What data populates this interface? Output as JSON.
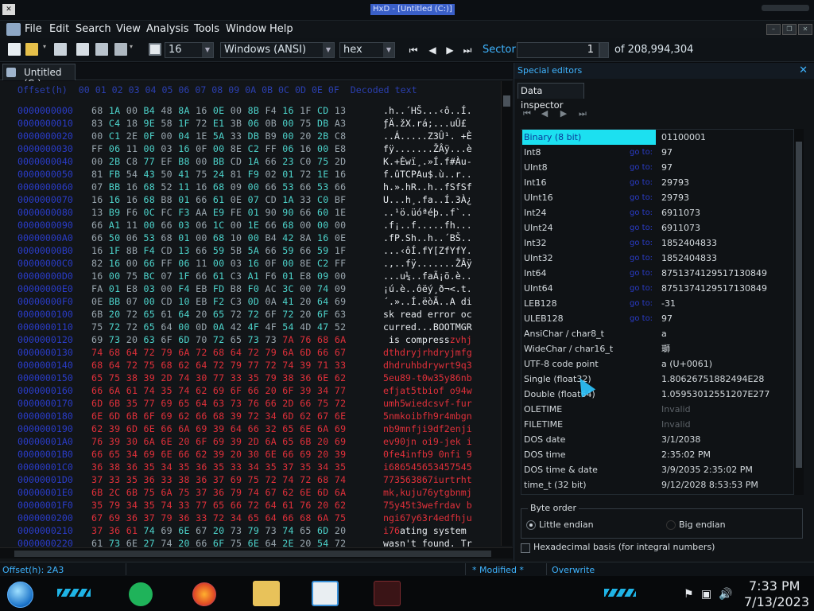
{
  "window": {
    "title": "HxD - [Untitled (C:)]",
    "logo_text": "✕"
  },
  "menu": [
    "File",
    "Edit",
    "Search",
    "View",
    "Analysis",
    "Tools",
    "Window",
    "Help"
  ],
  "toolbar": {
    "bytes_per_row": "16",
    "charset": "Windows (ANSI)",
    "display": "hex",
    "sector_label": "Sector",
    "sector_value": "1",
    "sector_total": "of 208,994,304"
  },
  "editor": {
    "tab_label": "Untitled (C:)",
    "header": "Offset(h)  00 01 02 03 04 05 06 07 08 09 0A 0B 0C 0D 0E 0F  Decoded text",
    "rows": [
      {
        "off": "0000000000",
        "hex": "68 1A 00 B4 48 8A 16 0E 00 8B F4 16 1F CD 13",
        "asc": ".h..´HŠ...‹ô..Í.",
        "style": "normal"
      },
      {
        "off": "0000000010",
        "hex": "83 C4 18 9E 58 1F 72 E1 3B 06 0B 00 75 DB A3",
        "asc": "ƒÄ.žX.rá;...uÛ£",
        "style": "normal"
      },
      {
        "off": "0000000020",
        "hex": "00 C1 2E 0F 00 04 1E 5A 33 DB B9 00 20 2B C8",
        "asc": "..Á.....Z3Û¹. +È",
        "style": "normal"
      },
      {
        "off": "0000000030",
        "hex": "FF 06 11 00 03 16 0F 00 8E C2 FF 06 16 00 E8",
        "asc": "fÿ.......ŽÂÿ...è",
        "style": "normal"
      },
      {
        "off": "0000000040",
        "hex": "00 2B C8 77 EF B8 00 BB CD 1A 66 23 C0 75 2D",
        "asc": "K.+Èwï¸.»Í.f#Àu-",
        "style": "normal"
      },
      {
        "off": "0000000050",
        "hex": "81 FB 54 43 50 41 75 24 81 F9 02 01 72 1E 16",
        "asc": "f.ûTCPAu$.ù..r..",
        "style": "normal"
      },
      {
        "off": "0000000060",
        "hex": "07 BB 16 68 52 11 16 68 09 00 66 53 66 53 66",
        "asc": "h.».hR..h..fSfSf",
        "style": "normal"
      },
      {
        "off": "0000000070",
        "hex": "16 16 16 68 B8 01 66 61 0E 07 CD 1A 33 C0 BF",
        "asc": "U...h¸.fa..Í.3À¿",
        "style": "normal"
      },
      {
        "off": "0000000080",
        "hex": "13 B9 F6 0C FC F3 AA E9 FE 01 90 90 66 60 1E",
        "asc": "..¹ö.üóªéþ..f`..",
        "style": "normal"
      },
      {
        "off": "0000000090",
        "hex": "66 A1 11 00 66 03 06 1C 00 1E 66 68 00 00 00",
        "asc": ".f¡..f.....fh...",
        "style": "normal"
      },
      {
        "off": "00000000A0",
        "hex": "66 50 06 53 68 01 00 68 10 00 B4 42 8A 16 0E",
        "asc": ".fP.Sh..h..´BŠ..",
        "style": "normal"
      },
      {
        "off": "00000000B0",
        "hex": "16 1F 8B F4 CD 13 66 59 5B 5A 66 59 66 59 1F",
        "asc": "...‹ôÍ.fY[ZfYfY.",
        "style": "normal"
      },
      {
        "off": "00000000C0",
        "hex": "82 16 00 66 FF 06 11 00 03 16 0F 00 8E C2 FF",
        "asc": ".,..fÿ.......ŽÂÿ",
        "style": "normal"
      },
      {
        "off": "00000000D0",
        "hex": "16 00 75 BC 07 1F 66 61 C3 A1 F6 01 E8 09 00",
        "asc": "...u¼..faÃ¡ö.è..",
        "style": "normal"
      },
      {
        "off": "00000000E0",
        "hex": "FA 01 E8 03 00 F4 EB FD B8 F0 AC 3C 00 74 09",
        "asc": "¡ú.è..ôëý¸ð¬<.t.",
        "style": "normal"
      },
      {
        "off": "00000000F0",
        "hex": "0E BB 07 00 CD 10 EB F2 C3 0D 0A 41 20 64 69",
        "asc": "´.»..Í.ëòÃ..A di",
        "style": "normal"
      },
      {
        "off": "0000000100",
        "hex": "6B 20 72 65 61 64 20 65 72 72 6F 72 20 6F 63",
        "asc": "sk read error oc",
        "style": "normal"
      },
      {
        "off": "0000000110",
        "hex": "75 72 72 65 64 00 0D 0A 42 4F 4F 54 4D 47 52",
        "asc": "curred...BOOTMGR",
        "style": "normal"
      },
      {
        "off": "0000000120",
        "hex": "69 73 20 63 6F 6D 70 72 65 73 73 7A 76 68 6A",
        "asc": " is compresszvhj",
        "style": "mixed",
        "split": 16
      },
      {
        "off": "0000000130",
        "hex": "74 68 64 72 79 6A 72 68 64 72 79 6A 6D 66 67",
        "asc": "dthdryjrhdryjmfg",
        "style": "red"
      },
      {
        "off": "0000000140",
        "hex": "68 64 72 75 68 62 64 72 79 77 72 74 39 71 33",
        "asc": "dhdruhbdrywrt9q3",
        "style": "red"
      },
      {
        "off": "0000000150",
        "hex": "65 75 38 39 2D 74 30 77 33 35 79 38 36 6E 62",
        "asc": "5eu89-t0w35y86nb",
        "style": "red"
      },
      {
        "off": "0000000160",
        "hex": "66 6A 61 74 35 74 62 69 6F 66 20 6F 39 34 77",
        "asc": "efjat5tbiof o94w",
        "style": "red"
      },
      {
        "off": "0000000170",
        "hex": "6D 6B 35 77 69 65 64 63 73 76 66 2D 66 75 72",
        "asc": "umh5wiedcsvf-fur",
        "style": "red"
      },
      {
        "off": "0000000180",
        "hex": "6E 6D 6B 6F 69 62 66 68 39 72 34 6D 62 67 6E",
        "asc": "5nmkoibfh9r4mbgn",
        "style": "red"
      },
      {
        "off": "0000000190",
        "hex": "62 39 6D 6E 66 6A 69 39 64 66 32 65 6E 6A 69",
        "asc": "nb9mnfji9df2enji",
        "style": "red"
      },
      {
        "off": "00000001A0",
        "hex": "76 39 30 6A 6E 20 6F 69 39 2D 6A 65 6B 20 69",
        "asc": "ev90jn oi9-jek i",
        "style": "red"
      },
      {
        "off": "00000001B0",
        "hex": "66 65 34 69 6E 66 62 39 20 30 6E 66 69 20 39",
        "asc": "0fe4infb9 0nfi 9",
        "style": "red"
      },
      {
        "off": "00000001C0",
        "hex": "36 38 36 35 34 35 36 35 33 34 35 37 35 34 35",
        "asc": "i686545653457545",
        "style": "red"
      },
      {
        "off": "00000001D0",
        "hex": "37 33 35 36 33 38 36 37 69 75 72 74 72 68 74",
        "asc": "773563867iurtrht",
        "style": "red"
      },
      {
        "off": "00000001E0",
        "hex": "6B 2C 6B 75 6A 75 37 36 79 74 67 62 6E 6D 6A",
        "asc": "mk,kuju76ytgbnmj",
        "style": "red"
      },
      {
        "off": "00000001F0",
        "hex": "35 79 34 35 74 33 77 65 66 72 64 61 76 20 62",
        "asc": "75y45t3wefrdav b",
        "style": "red"
      },
      {
        "off": "0000000200",
        "hex": "67 69 36 37 79 36 33 72 34 65 64 66 68 6A 75",
        "asc": "ngi67y63r4edfhju",
        "style": "red"
      },
      {
        "off": "0000000210",
        "hex": "37 36 61 74 69 6E 67 20 73 79 73 74 65 6D 20",
        "asc": "i76ating system ",
        "style": "mixed",
        "split": 3
      },
      {
        "off": "0000000220",
        "hex": "61 73 6E 27 74 20 66 6F 75 6E 64 2E 20 54 72",
        "asc": "wasn't found. Tr",
        "style": "normal"
      }
    ]
  },
  "inspector": {
    "panel_title": "Special editors",
    "tab_label": "Data inspector",
    "rows": [
      {
        "name": "Binary (8 bit)",
        "link": "",
        "value": "01100001",
        "selected": true
      },
      {
        "name": "Int8",
        "link": "go to:",
        "value": "97"
      },
      {
        "name": "UInt8",
        "link": "go to:",
        "value": "97"
      },
      {
        "name": "Int16",
        "link": "go to:",
        "value": "29793"
      },
      {
        "name": "UInt16",
        "link": "go to:",
        "value": "29793"
      },
      {
        "name": "Int24",
        "link": "go to:",
        "value": "6911073"
      },
      {
        "name": "UInt24",
        "link": "go to:",
        "value": "6911073"
      },
      {
        "name": "Int32",
        "link": "go to:",
        "value": "1852404833"
      },
      {
        "name": "UInt32",
        "link": "go to:",
        "value": "1852404833"
      },
      {
        "name": "Int64",
        "link": "go to:",
        "value": "8751374129517130849"
      },
      {
        "name": "UInt64",
        "link": "go to:",
        "value": "8751374129517130849"
      },
      {
        "name": "LEB128",
        "link": "go to:",
        "value": "-31"
      },
      {
        "name": "ULEB128",
        "link": "go to:",
        "value": "97"
      },
      {
        "name": "AnsiChar / char8_t",
        "link": "",
        "value": "a"
      },
      {
        "name": "WideChar / char16_t",
        "link": "",
        "value": "瑡"
      },
      {
        "name": "UTF-8 code point",
        "link": "",
        "value": "a (U+0061)"
      },
      {
        "name": "Single (float32)",
        "link": "",
        "value": "1.80626751882494E28"
      },
      {
        "name": "Double (float64)",
        "link": "",
        "value": "1.05953012551207E277"
      },
      {
        "name": "OLETIME",
        "link": "",
        "value": "Invalid",
        "dim": true
      },
      {
        "name": "FILETIME",
        "link": "",
        "value": "Invalid",
        "dim": true
      },
      {
        "name": "DOS date",
        "link": "",
        "value": "3/1/2038"
      },
      {
        "name": "DOS time",
        "link": "",
        "value": "2:35:02 PM"
      },
      {
        "name": "DOS time & date",
        "link": "",
        "value": "3/9/2035 2:35:02 PM"
      },
      {
        "name": "time_t (32 bit)",
        "link": "",
        "value": "9/12/2028 8:53:53 PM"
      }
    ],
    "byte_order_label": "Byte order",
    "little_endian": "Little endian",
    "big_endian": "Big endian",
    "hex_basis_label": "Hexadecimal basis (for integral numbers)"
  },
  "status": {
    "offset": "Offset(h): 2A3",
    "modified": "* Modified *",
    "mode": "Overwrite"
  },
  "clock": {
    "time": "7:33 PM",
    "date": "7/13/2023"
  },
  "colors": {
    "accent": "#3fb4ff",
    "red_text": "#e0303a",
    "offset_blue": "#2a3cc8"
  }
}
